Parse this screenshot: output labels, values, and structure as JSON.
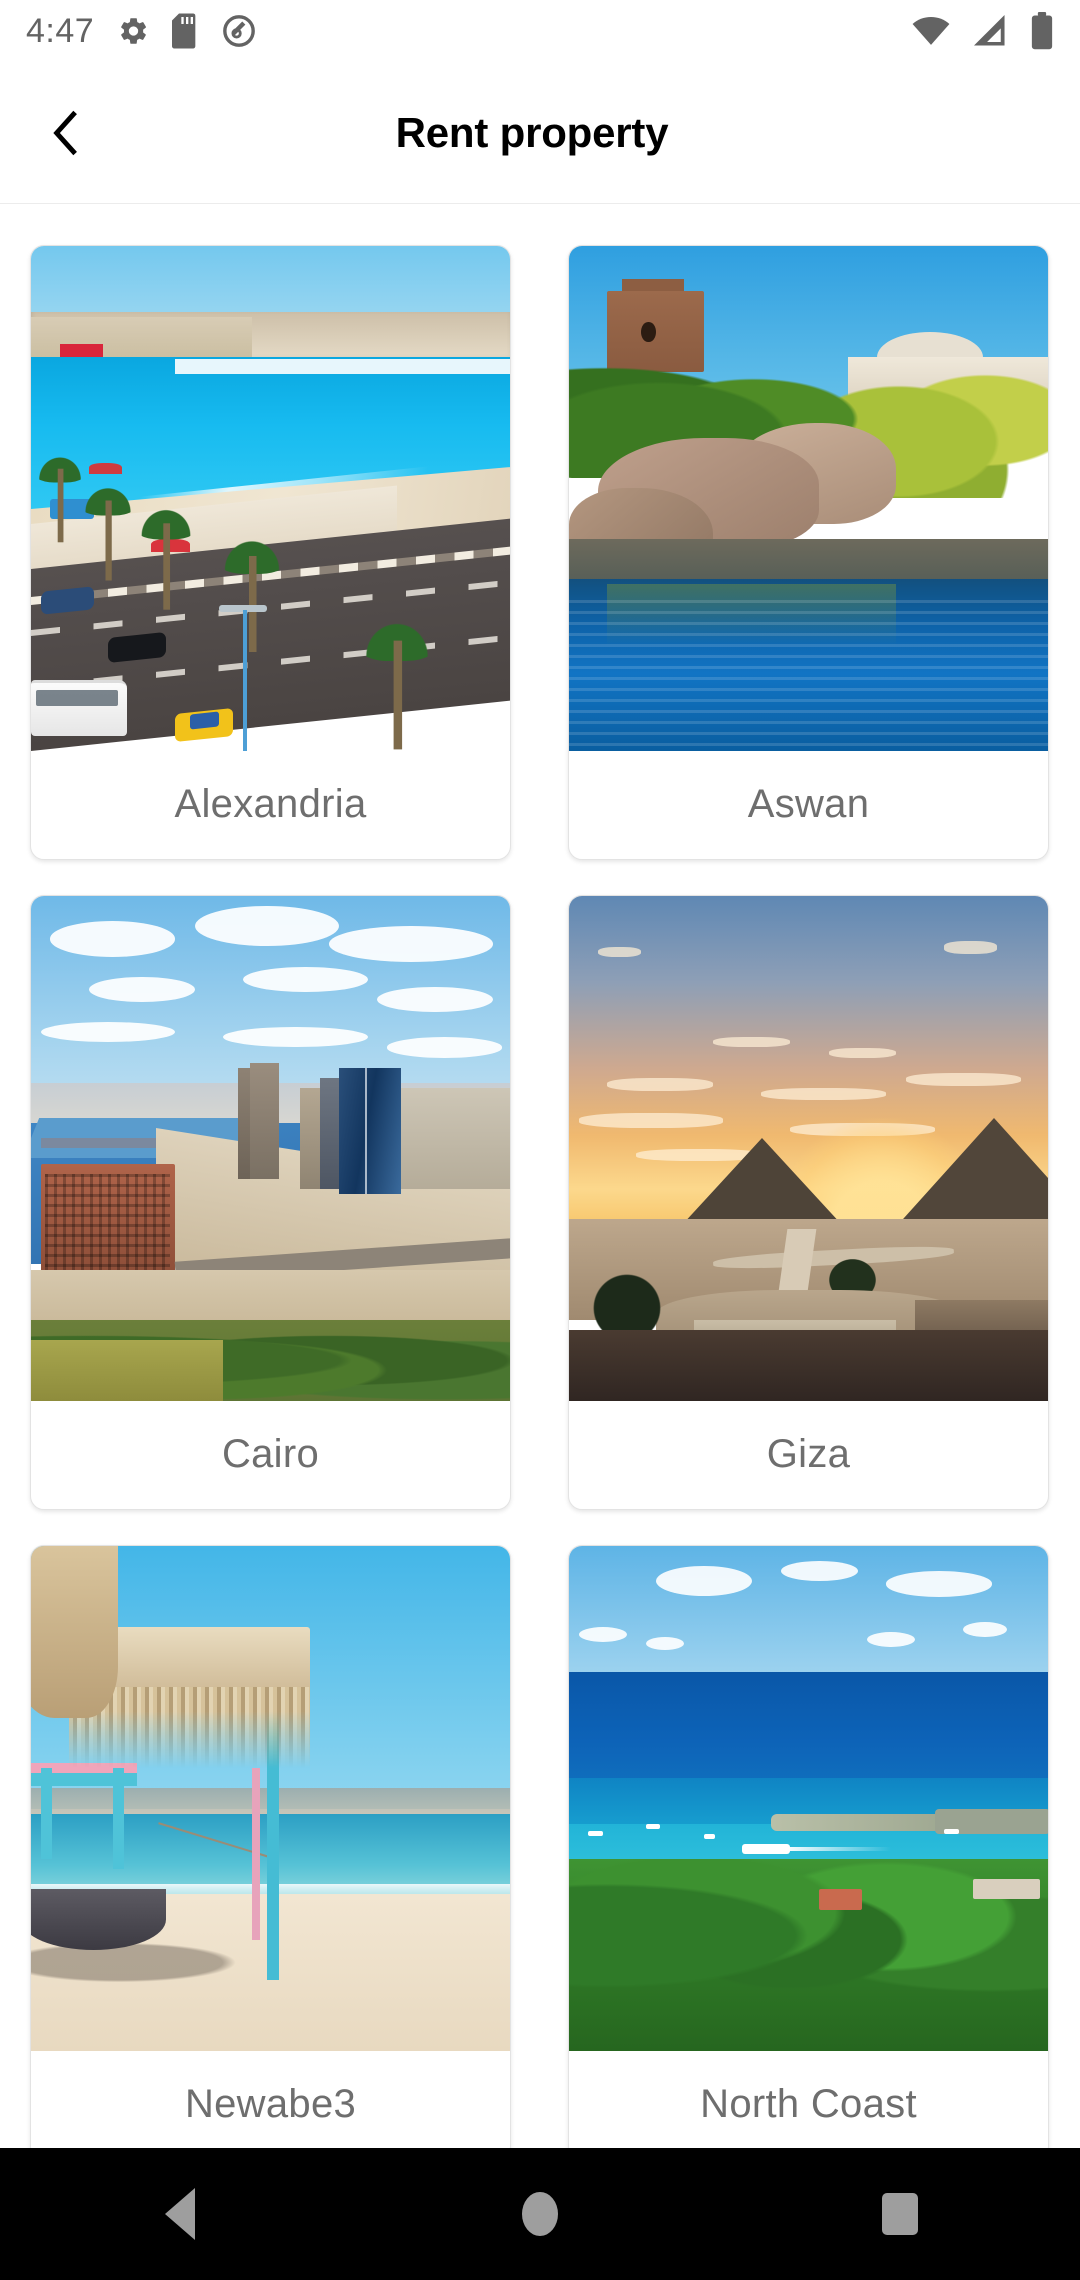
{
  "status_bar": {
    "time": "4:47",
    "left_icons": [
      "gear-icon",
      "sd-card-icon",
      "data-saver-icon"
    ],
    "right_icons": [
      "wifi-icon",
      "cellular-signal-icon",
      "battery-icon"
    ]
  },
  "app_bar": {
    "back_label": "back-icon",
    "title": "Rent property"
  },
  "grid": {
    "columns": 2,
    "cards": [
      {
        "label": "Alexandria",
        "scene": "alexandria-corniche"
      },
      {
        "label": "Aswan",
        "scene": "aswan-nile-rocks"
      },
      {
        "label": "Cairo",
        "scene": "cairo-skyline-nile"
      },
      {
        "label": "Giza",
        "scene": "giza-pyramids-sunset"
      },
      {
        "label": "Newabe3",
        "scene": "newabe3-beach-hut"
      },
      {
        "label": "North Coast",
        "scene": "north-coast-sea"
      }
    ]
  },
  "nav_bar": {
    "back": "nav-back-icon",
    "home": "nav-home-icon",
    "recents": "nav-recents-icon"
  },
  "colors": {
    "label_text": "#6e6e6e",
    "title_text": "#000000",
    "card_border": "#e3e3e3",
    "status_text": "#636363",
    "nav_icon": "#9e9e9e",
    "nav_background": "#000000",
    "page_background": "#ffffff"
  }
}
